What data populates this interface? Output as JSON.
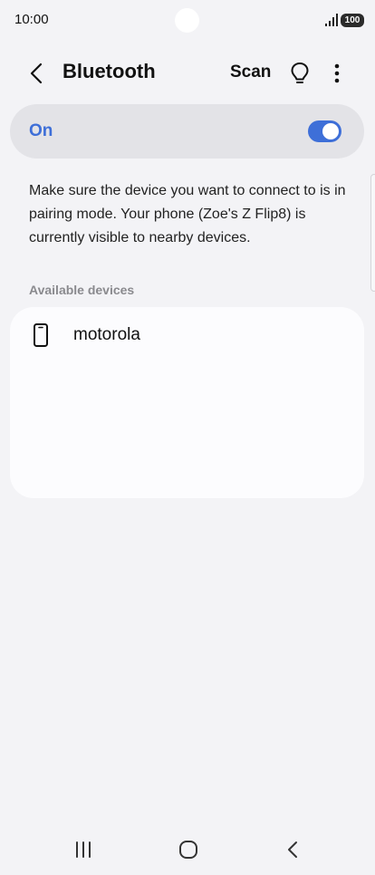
{
  "status_bar": {
    "time": "10:00",
    "battery": "100",
    "icons": [
      "signal-icon",
      "battery-icon"
    ]
  },
  "header": {
    "title": "Bluetooth",
    "scan_label": "Scan",
    "icons": [
      "back-arrow-icon",
      "lightbulb-icon",
      "more-vertical-icon"
    ]
  },
  "toggle": {
    "label": "On",
    "state": "on",
    "accent_color": "#3e6fd8"
  },
  "description": "Make sure the device you want to connect to is in pairing mode. Your phone (Zoe's Z Flip8) is currently visible to nearby devices.",
  "available_devices": {
    "header": "Available devices",
    "items": [
      {
        "name": "motorola",
        "icon": "phone-icon"
      }
    ]
  },
  "nav_bar": {
    "icons": [
      "recents-icon",
      "home-icon",
      "back-icon"
    ]
  }
}
